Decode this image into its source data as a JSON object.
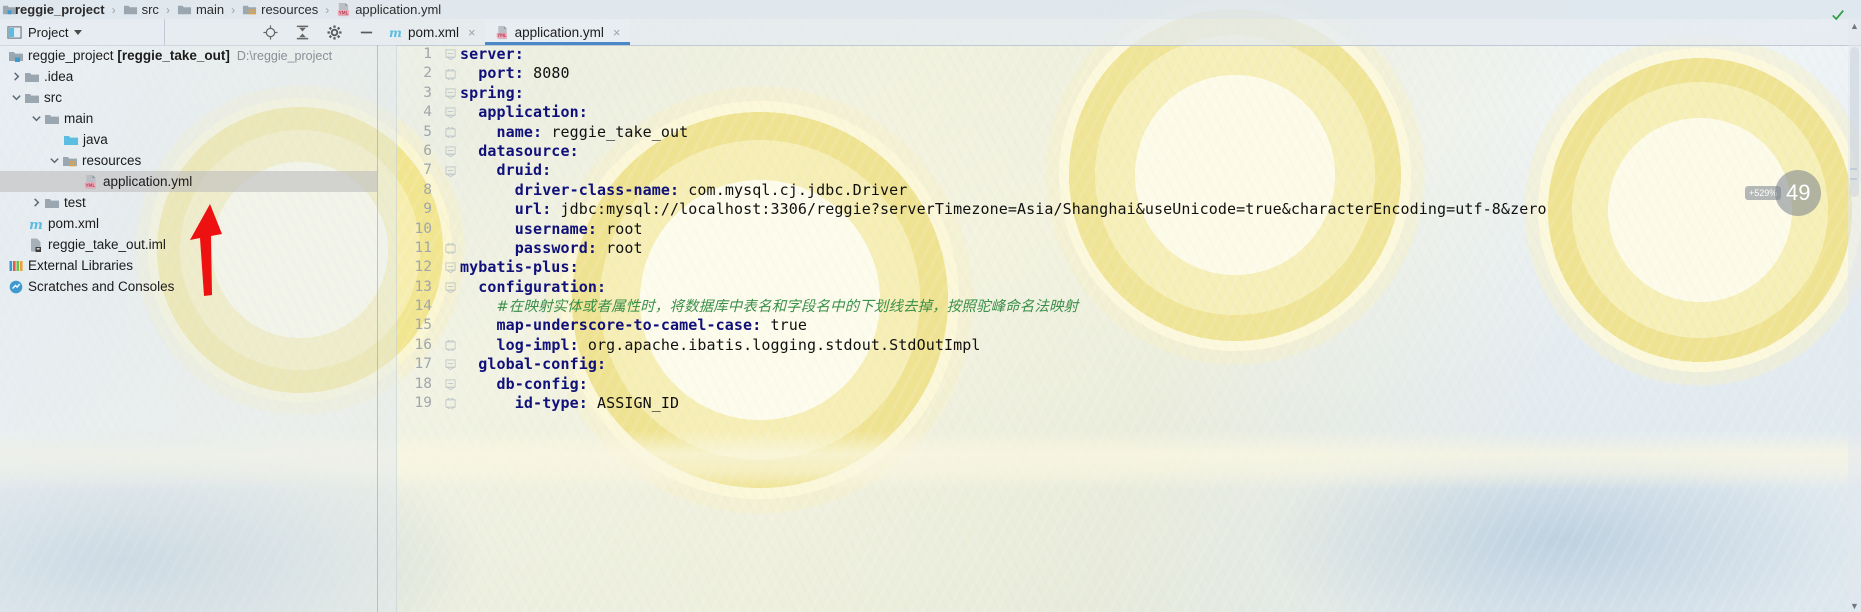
{
  "breadcrumb": {
    "items": [
      {
        "label": "reggie_project",
        "icon": "project-icon",
        "bold": true
      },
      {
        "label": "src",
        "icon": "folder-icon",
        "bold": false
      },
      {
        "label": "main",
        "icon": "folder-icon",
        "bold": false
      },
      {
        "label": "resources",
        "icon": "resources-folder-icon",
        "bold": false
      },
      {
        "label": "application.yml",
        "icon": "yml-file-icon",
        "bold": false
      }
    ],
    "separator": "›"
  },
  "project_panel": {
    "title": "Project",
    "dropdown_caret": "caret-down-icon",
    "tools": [
      {
        "name": "locate-icon"
      },
      {
        "name": "collapse-all-icon"
      },
      {
        "name": "settings-gear-icon"
      },
      {
        "name": "hide-icon"
      }
    ],
    "tree": [
      {
        "label": "reggie_project",
        "module": "[reggie_take_out]",
        "path": "D:\\reggie_project",
        "indent": 0,
        "twisty": "none",
        "icon": "project-root-icon",
        "selected": false
      },
      {
        "label": ".idea",
        "indent": 1,
        "twisty": "collapsed",
        "icon": "folder-icon",
        "selected": false
      },
      {
        "label": "src",
        "indent": 1,
        "twisty": "expanded",
        "icon": "folder-icon",
        "selected": false
      },
      {
        "label": "main",
        "indent": 2,
        "twisty": "expanded",
        "icon": "folder-icon",
        "selected": false
      },
      {
        "label": "java",
        "indent": 3,
        "twisty": "none",
        "icon": "source-folder-icon",
        "selected": false
      },
      {
        "label": "resources",
        "indent": 3,
        "twisty": "expanded",
        "icon": "resources-folder-icon",
        "selected": false
      },
      {
        "label": "application.yml",
        "indent": 4,
        "twisty": "none",
        "icon": "yml-file-icon",
        "selected": true
      },
      {
        "label": "test",
        "indent": 2,
        "twisty": "collapsed",
        "icon": "folder-icon",
        "selected": false
      },
      {
        "label": "pom.xml",
        "indent": 1,
        "twisty": "none",
        "icon": "maven-file-icon",
        "selected": false
      },
      {
        "label": "reggie_take_out.iml",
        "indent": 1,
        "twisty": "none",
        "icon": "iml-file-icon",
        "selected": false
      },
      {
        "label": "External Libraries",
        "indent": 0,
        "twisty": "none",
        "icon": "libraries-icon",
        "selected": false
      },
      {
        "label": "Scratches and Consoles",
        "indent": 0,
        "twisty": "none",
        "icon": "scratches-icon",
        "selected": false
      }
    ]
  },
  "editor_tabs": [
    {
      "label": "pom.xml",
      "icon": "maven-file-icon",
      "active": false,
      "close": "×"
    },
    {
      "label": "application.yml",
      "icon": "yml-file-icon",
      "active": true,
      "close": "×"
    }
  ],
  "editor": {
    "filename": "application.yml",
    "line_numbers": [
      "1",
      "2",
      "3",
      "4",
      "5",
      "6",
      "7",
      "8",
      "9",
      "10",
      "11",
      "12",
      "13",
      "14",
      "15",
      "16",
      "17",
      "18",
      "19"
    ],
    "lines": [
      {
        "n": "1",
        "indent": 0,
        "key": "server:",
        "value": "",
        "fold": "open",
        "type": "key"
      },
      {
        "n": "2",
        "indent": 1,
        "key": "port:",
        "value": "8080",
        "fold": "endcap",
        "type": "kv"
      },
      {
        "n": "3",
        "indent": 0,
        "key": "spring:",
        "value": "",
        "fold": "open",
        "type": "key"
      },
      {
        "n": "4",
        "indent": 1,
        "key": "application:",
        "value": "",
        "fold": "open",
        "type": "key"
      },
      {
        "n": "5",
        "indent": 2,
        "key": "name:",
        "value": "reggie_take_out",
        "fold": "endcap",
        "type": "kv"
      },
      {
        "n": "6",
        "indent": 1,
        "key": "datasource:",
        "value": "",
        "fold": "open",
        "type": "key"
      },
      {
        "n": "7",
        "indent": 2,
        "key": "druid:",
        "value": "",
        "fold": "open",
        "type": "key"
      },
      {
        "n": "8",
        "indent": 3,
        "key": "driver-class-name:",
        "value": "com.mysql.cj.jdbc.Driver",
        "fold": "none",
        "type": "kv"
      },
      {
        "n": "9",
        "indent": 3,
        "key": "url:",
        "value": "jdbc:mysql://localhost:3306/reggie?serverTimezone=Asia/Shanghai&useUnicode=true&characterEncoding=utf-8&zero",
        "fold": "none",
        "type": "kv"
      },
      {
        "n": "10",
        "indent": 3,
        "key": "username:",
        "value": "root",
        "fold": "none",
        "type": "kv"
      },
      {
        "n": "11",
        "indent": 3,
        "key": "password:",
        "value": "root",
        "fold": "endcap",
        "type": "kv"
      },
      {
        "n": "12",
        "indent": 0,
        "key": "mybatis-plus:",
        "value": "",
        "fold": "open",
        "type": "key"
      },
      {
        "n": "13",
        "indent": 1,
        "key": "configuration:",
        "value": "",
        "fold": "open",
        "type": "key"
      },
      {
        "n": "14",
        "indent": 2,
        "key": "",
        "value": "",
        "comment": "#在映射实体或者属性时，将数据库中表名和字段名中的下划线去掉，按照驼峰命名法映射",
        "fold": "none",
        "type": "comment"
      },
      {
        "n": "15",
        "indent": 2,
        "key": "map-underscore-to-camel-case:",
        "value": "true",
        "fold": "none",
        "type": "kv"
      },
      {
        "n": "16",
        "indent": 2,
        "key": "log-impl:",
        "value": "org.apache.ibatis.logging.stdout.StdOutImpl",
        "fold": "endcap",
        "type": "kv"
      },
      {
        "n": "17",
        "indent": 1,
        "key": "global-config:",
        "value": "",
        "fold": "open",
        "type": "key"
      },
      {
        "n": "18",
        "indent": 2,
        "key": "db-config:",
        "value": "",
        "fold": "open",
        "type": "key"
      },
      {
        "n": "19",
        "indent": 3,
        "key": "id-type:",
        "value": "ASSIGN_ID",
        "fold": "endcap",
        "type": "kv"
      }
    ],
    "inspection_status": "ok-checkmark"
  },
  "zoom_badge": {
    "delta": "+529%",
    "value": "49"
  },
  "colors": {
    "key": "#10107a",
    "value": "#101010",
    "comment": "#3a8f4a",
    "tab_underline": "#4a88c7",
    "selection": "#bebebe",
    "arrow": "#ee1111",
    "ok": "#2f9e44"
  }
}
